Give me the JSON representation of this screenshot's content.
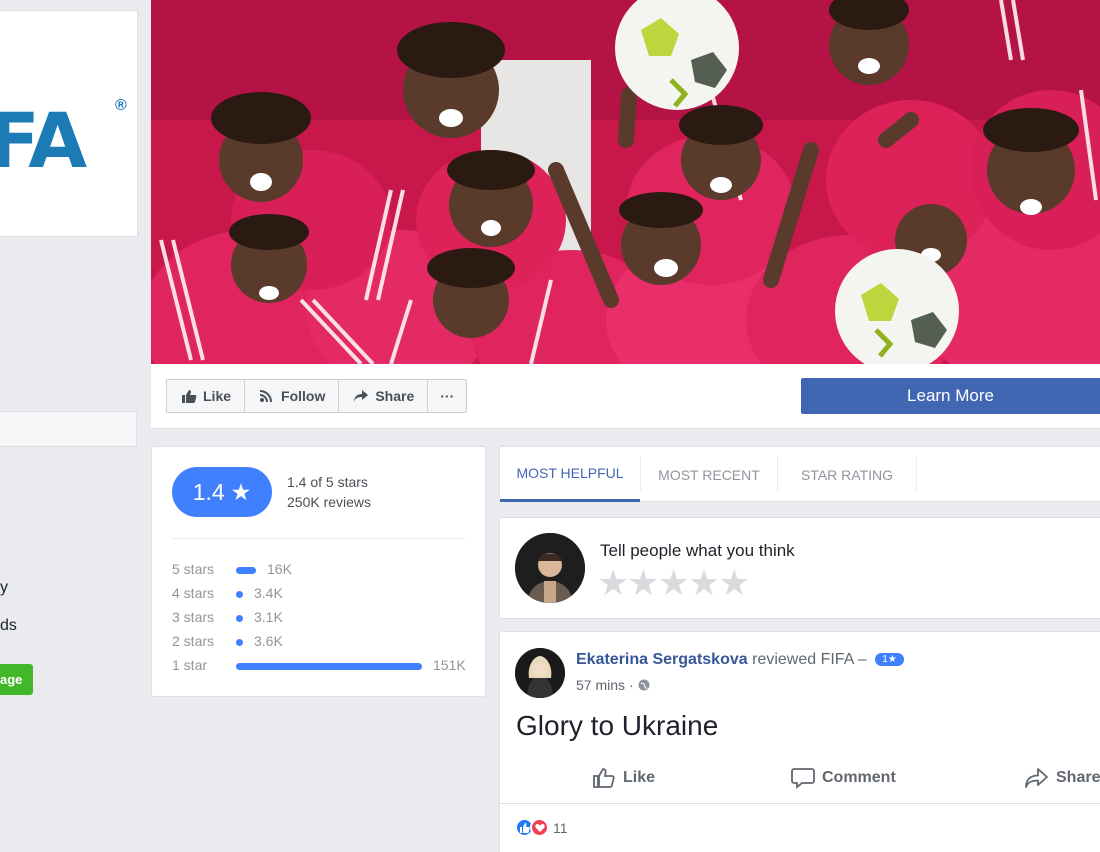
{
  "logo": {
    "text": "FA",
    "reg": "®"
  },
  "left_fragments": {
    "frag1": "y",
    "frag2": "ds",
    "green_button": "age"
  },
  "page_actions": {
    "like": "Like",
    "follow": "Follow",
    "share": "Share",
    "more": "···",
    "learn_more": "Learn More"
  },
  "rating": {
    "score": "1.4",
    "summary": "1.4 of 5 stars",
    "reviews": "250K reviews",
    "distribution": [
      {
        "label": "5 stars",
        "count": "16K",
        "fraction": 0.106
      },
      {
        "label": "4 stars",
        "count": "3.4K",
        "fraction": 0.02
      },
      {
        "label": "3 stars",
        "count": "3.1K",
        "fraction": 0.02
      },
      {
        "label": "2 stars",
        "count": "3.6K",
        "fraction": 0.02
      },
      {
        "label": "1 star",
        "count": "151K",
        "fraction": 1.0
      }
    ]
  },
  "tabs": [
    "MOST HELPFUL",
    "MOST RECENT",
    "STAR RATING"
  ],
  "write_review": {
    "prompt": "Tell people what you think",
    "stars": "★★★★★"
  },
  "review": {
    "author": "Ekaterina Sergatskova",
    "action": "reviewed FIFA –",
    "badge": "1★",
    "time": "57 mins",
    "time_sep": "·",
    "body": "Glory to Ukraine",
    "like": "Like",
    "comment": "Comment",
    "share": "Share",
    "reaction_count": "11"
  },
  "colors": {
    "accent": "#4267b2",
    "rating_blue": "#4080ff",
    "fifa_blue": "#1c7bb5",
    "cover_red": "#d81b4a"
  }
}
